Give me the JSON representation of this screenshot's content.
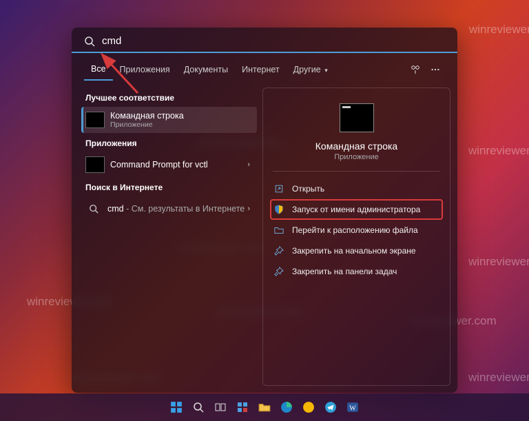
{
  "watermark_text": "winreviewer.com",
  "search": {
    "value": "cmd"
  },
  "tabs": {
    "all": "Все",
    "apps": "Приложения",
    "docs": "Документы",
    "internet": "Интернет",
    "more": "Другие"
  },
  "sections": {
    "best_match": "Лучшее соответствие",
    "apps": "Приложения",
    "web": "Поиск в Интернете"
  },
  "results": {
    "best": {
      "title": "Командная строка",
      "sub": "Приложение"
    },
    "app_vctl": "Command Prompt for vctl",
    "web_cmd_prefix": "cmd",
    "web_cmd_suffix": " - См. результаты в Интернете"
  },
  "preview": {
    "title": "Командная строка",
    "sub": "Приложение",
    "actions": {
      "open": "Открыть",
      "run_admin": "Запуск от имени администратора",
      "open_location": "Перейти к расположению файла",
      "pin_start": "Закрепить на начальном экране",
      "pin_taskbar": "Закрепить на панели задач"
    }
  }
}
